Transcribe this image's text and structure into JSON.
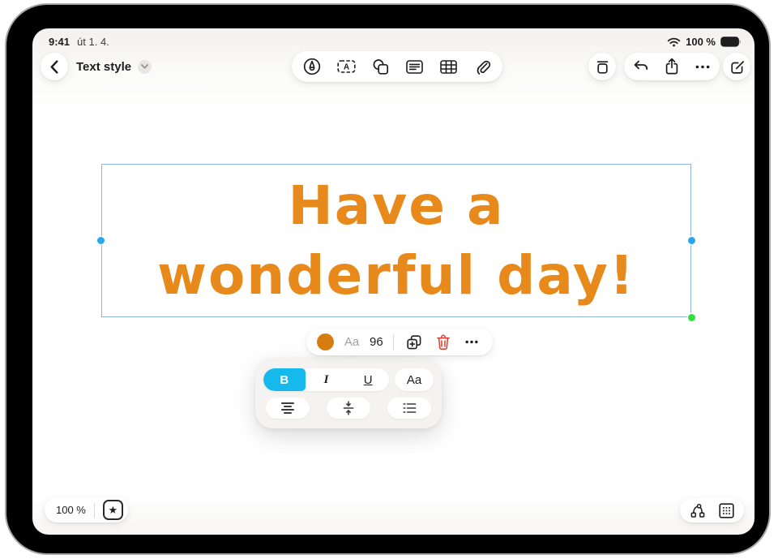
{
  "status_bar": {
    "time": "9:41",
    "date": "út 1. 4.",
    "battery_level": "100 %"
  },
  "nav": {
    "title": "Text style"
  },
  "toolbar_icons": [
    "draw-tool-icon",
    "text-box-tool-icon",
    "shapes-tool-icon",
    "note-tool-icon",
    "table-tool-icon",
    "attachment-tool-icon"
  ],
  "action_icons": [
    "delete-board-icon",
    "undo-icon",
    "share-icon",
    "more-icon",
    "new-board-icon"
  ],
  "board": {
    "text_line1": "Have a",
    "text_line2": "wonderful day!",
    "text_color": "#E8891B"
  },
  "context_toolbar": {
    "style_button_label": "Aa",
    "font_size": "96",
    "icons": [
      "color-swatch",
      "duplicate-icon",
      "delete-icon",
      "more-options-icon"
    ]
  },
  "format_popup": {
    "bold_label": "B",
    "italic_label": "I",
    "underline_label": "U",
    "style_label": "Aa",
    "bold_selected": true,
    "icons": [
      "align-center-icon",
      "vertical-align-center-icon",
      "list-icon"
    ]
  },
  "footer": {
    "zoom_level": "100 %",
    "star_glyph": "★",
    "icons": [
      "favorites-star-icon",
      "connect-shapes-icon",
      "snap-grid-icon"
    ]
  },
  "colors": {
    "accent_cyan": "#16B9EC",
    "text_orange": "#E8891B",
    "swatch_orange": "#D67D12",
    "delete_red": "#E0382D",
    "selection_border": "#8FB2E6",
    "handle_blue": "#29A9E9",
    "handle_green": "#30DF3F"
  }
}
